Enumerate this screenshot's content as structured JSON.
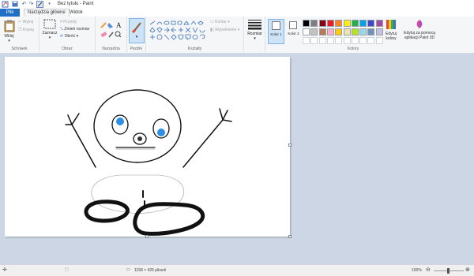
{
  "window": {
    "title": "Bez tytułu - Paint"
  },
  "quick_access": [
    "save-icon",
    "undo-icon",
    "redo-icon",
    "customize-icon"
  ],
  "tabs": {
    "file": "Plik",
    "home": "Narzędzia główne",
    "view": "Widok"
  },
  "ribbon": {
    "clipboard": {
      "paste": "Wklej",
      "cut": "Wytnij",
      "copy": "Kopiuj",
      "label": "Schowek"
    },
    "image": {
      "select": "Zaznacz",
      "crop": "Przytnij",
      "resize": "Zmień rozmiar",
      "rotate": "Obróć",
      "label": "Obraz"
    },
    "tools": {
      "label": "Narzędzia"
    },
    "brushes": {
      "label": "Pędzle"
    },
    "shapes": {
      "outline": "Kontur",
      "fill": "Wypełnienie",
      "label": "Kształty"
    },
    "size": {
      "label": "Rozmiar"
    },
    "colors": {
      "color1": "Kolor 1",
      "color2": "Kolor 2",
      "edit": "Edytuj kolory",
      "paint3d": "Edytuj za pomocą aplikacji Paint 3D",
      "label": "Kolory",
      "palette_row1": [
        "#000000",
        "#7f7f7f",
        "#880015",
        "#ed1c24",
        "#ff7f27",
        "#fff200",
        "#22b14c",
        "#00a2e8",
        "#3f48cc",
        "#a349a4"
      ],
      "palette_row2": [
        "#ffffff",
        "#c3c3c3",
        "#b97a57",
        "#ffaec9",
        "#ffc90e",
        "#efe4b0",
        "#b5e61d",
        "#99d9ea",
        "#7092be",
        "#c8bfe7"
      ]
    }
  },
  "status": {
    "dimensions": "1158 × 426 pikseli",
    "zoom": "100%"
  }
}
